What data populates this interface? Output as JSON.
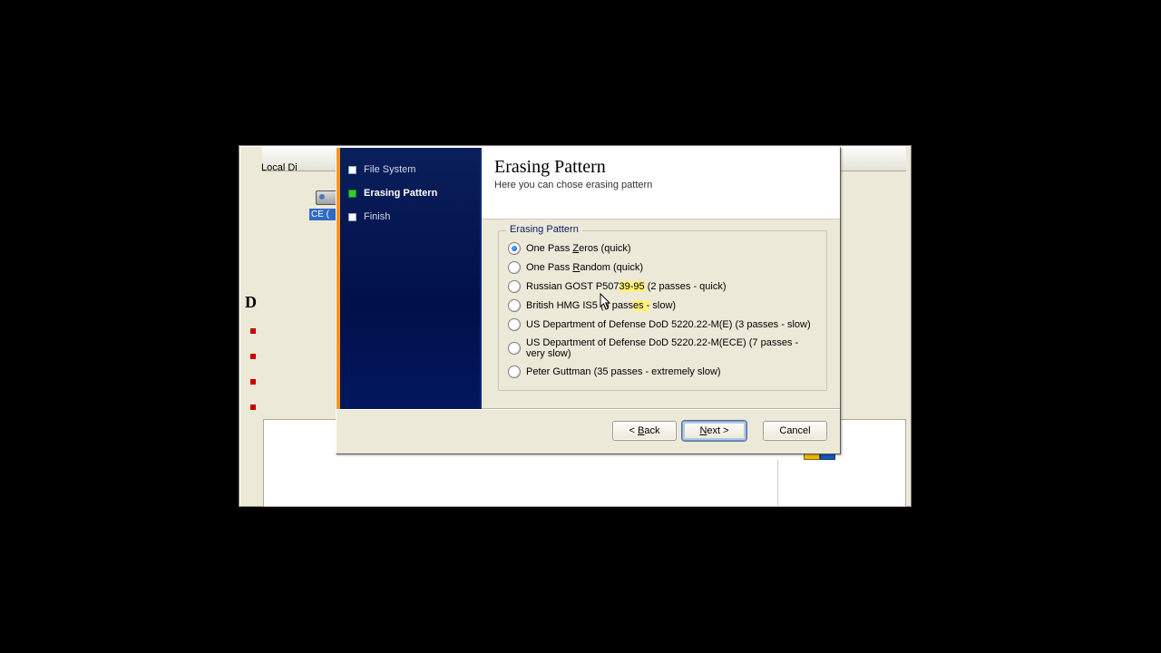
{
  "background": {
    "local_disk": "Local Di",
    "sel_label": "CE (",
    "d_letter": "D"
  },
  "wizard": {
    "steps": {
      "file_system": "File System",
      "erasing_pattern": "Erasing Pattern",
      "finish": "Finish"
    },
    "title": "Erasing Pattern",
    "subtitle": "Here you can chose erasing pattern",
    "group_legend": "Erasing Pattern",
    "options": {
      "one_pass_zeros_pre": "One Pass ",
      "one_pass_zeros_u": "Z",
      "one_pass_zeros_post": "eros (quick)",
      "one_pass_random_pre": "One Pass ",
      "one_pass_random_u": "R",
      "one_pass_random_post": "andom (quick)",
      "gost_pre": "Russian GOST P507",
      "gost_hl": "39-95",
      "gost_post": " (2 passes - quick)",
      "british_pre": "British HMG IS5 (3 pass",
      "british_hl": "es -",
      "british_post": " slow)",
      "dod_e": "US Department of Defense DoD 5220.22-M(E) (3 passes - slow)",
      "dod_ece": "US Department of Defense DoD 5220.22-M(ECE) (7 passes - very slow)",
      "guttman": "Peter Guttman (35 passes - extremely slow)"
    },
    "buttons": {
      "back_pre": "< ",
      "back_u": "B",
      "back_post": "ack",
      "next_u": "N",
      "next_post": "ext >",
      "cancel": "Cancel"
    }
  }
}
